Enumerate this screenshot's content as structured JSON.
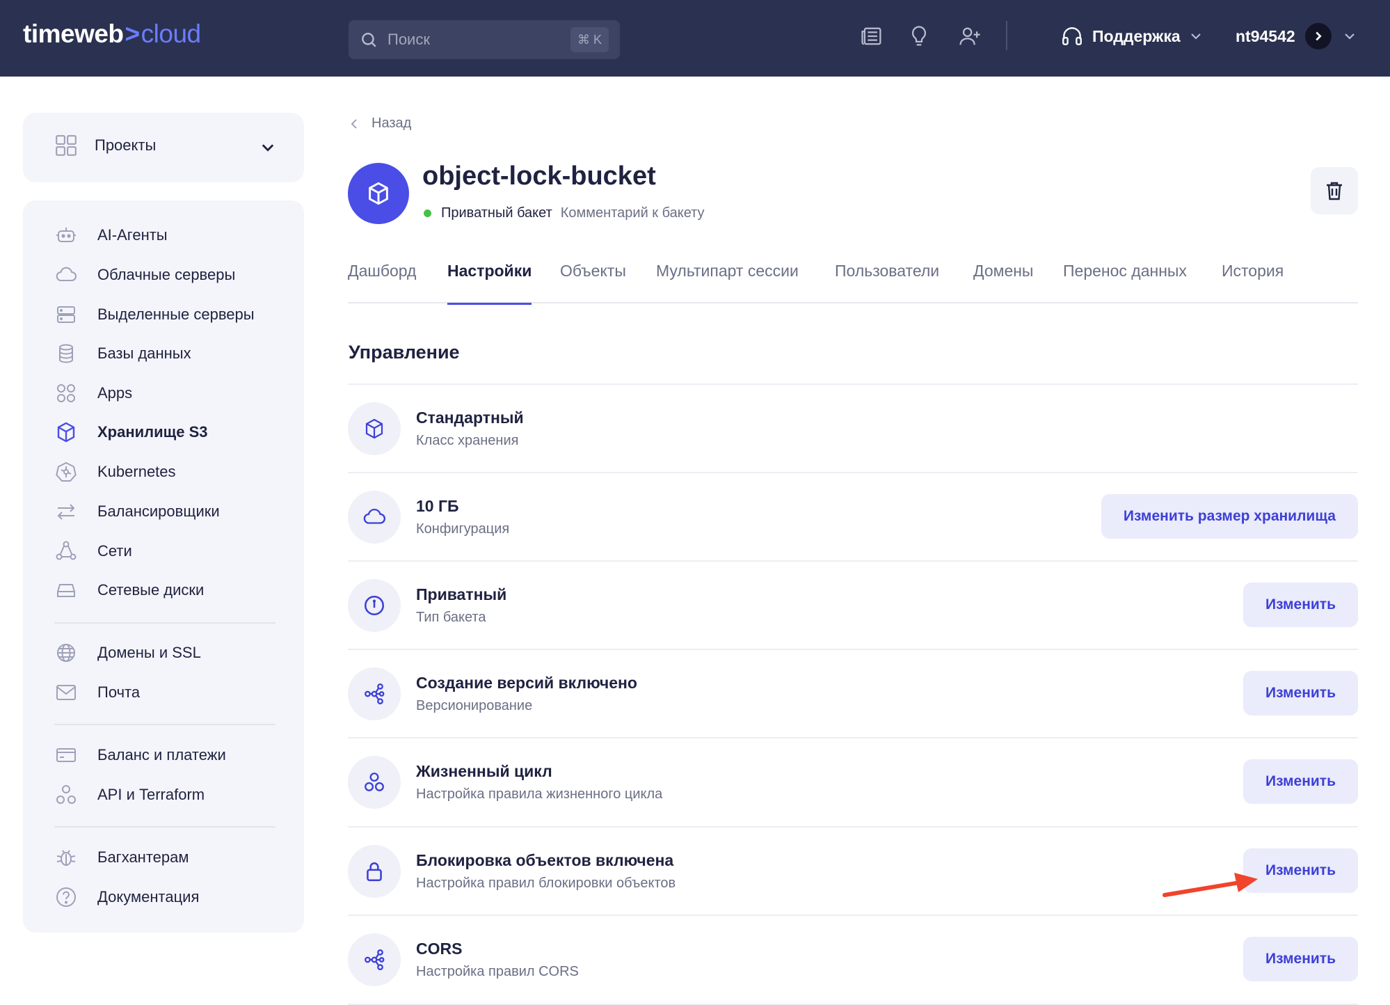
{
  "header": {
    "logo_left": "timeweb",
    "logo_chevron": ">",
    "logo_right": "cloud",
    "search": {
      "placeholder": "Поиск",
      "shortcut": "⌘ K"
    },
    "support_label": "Поддержка",
    "user_label": "nt94542"
  },
  "sidebar": {
    "projects_label": "Проекты",
    "items": [
      {
        "label": "AI-Агенты",
        "icon": "robot-icon"
      },
      {
        "label": "Облачные серверы",
        "icon": "cloud-icon"
      },
      {
        "label": "Выделенные серверы",
        "icon": "server-icon"
      },
      {
        "label": "Базы данных",
        "icon": "database-icon"
      },
      {
        "label": "Apps",
        "icon": "apps-icon"
      },
      {
        "label": "Хранилище S3",
        "icon": "cube-icon",
        "active": true
      },
      {
        "label": "Kubernetes",
        "icon": "kubernetes-icon"
      },
      {
        "label": "Балансировщики",
        "icon": "arrows-icon"
      },
      {
        "label": "Сети",
        "icon": "network-icon"
      },
      {
        "label": "Сетевые диски",
        "icon": "disk-icon"
      },
      {
        "label": "Домены и SSL",
        "icon": "globe-icon"
      },
      {
        "label": "Почта",
        "icon": "mail-icon"
      },
      {
        "label": "Баланс и платежи",
        "icon": "card-icon"
      },
      {
        "label": "API и Terraform",
        "icon": "api-icon"
      },
      {
        "label": "Багхантерам",
        "icon": "bug-icon"
      },
      {
        "label": "Документация",
        "icon": "help-icon"
      }
    ]
  },
  "main": {
    "back_label": "Назад",
    "bucket": {
      "name": "object-lock-bucket",
      "status": "Приватный бакет",
      "comment": "Комментарий к бакету"
    },
    "tabs": [
      {
        "label": "Дашборд"
      },
      {
        "label": "Настройки",
        "active": true
      },
      {
        "label": "Объекты"
      },
      {
        "label": "Мультипарт сессии"
      },
      {
        "label": "Пользователи"
      },
      {
        "label": "Домены"
      },
      {
        "label": "Перенос данных"
      },
      {
        "label": "История"
      }
    ],
    "section_title": "Управление",
    "settings": [
      {
        "title": "Стандартный",
        "desc": "Класс хранения",
        "icon": "cube-icon",
        "button": ""
      },
      {
        "title": "10 ГБ",
        "desc": "Конфигурация",
        "icon": "cloud-icon",
        "button": "Изменить размер хранилища"
      },
      {
        "title": "Приватный",
        "desc": "Тип бакета",
        "icon": "keyhole-icon",
        "button": "Изменить"
      },
      {
        "title": "Создание версий включено",
        "desc": "Версионирование",
        "icon": "share-icon",
        "button": "Изменить"
      },
      {
        "title": "Жизненный цикл",
        "desc": "Настройка правила жизненного цикла",
        "icon": "circles-icon",
        "button": "Изменить"
      },
      {
        "title": "Блокировка объектов включена",
        "desc": "Настройка правил блокировки объектов",
        "icon": "lock-icon",
        "button": "Изменить"
      },
      {
        "title": "CORS",
        "desc": "Настройка правил CORS",
        "icon": "share-icon",
        "button": "Изменить"
      }
    ]
  },
  "colors": {
    "header_bg": "#2b3150",
    "accent": "#4a4ee6",
    "annotation_arrow": "#f0442c"
  }
}
